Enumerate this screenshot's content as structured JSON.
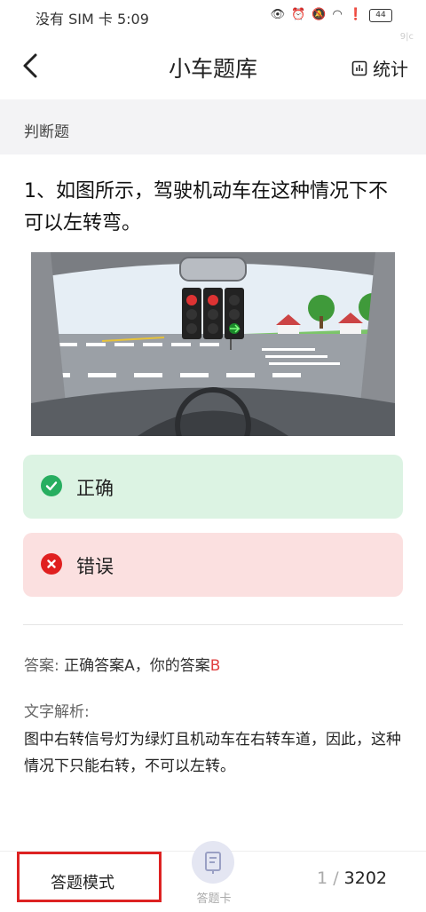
{
  "status_bar": {
    "time": "没有 SIM 卡 5:09",
    "battery": "44"
  },
  "header": {
    "title": "小车题库",
    "stats_label": "统计",
    "watermark": "9|c"
  },
  "section": {
    "label": "判断题"
  },
  "question": {
    "text": "1、如图所示，驾驶机动车在这种情况下不可以左转弯。"
  },
  "options": [
    {
      "label": "正确",
      "state": "correct"
    },
    {
      "label": "错误",
      "state": "wrong"
    }
  ],
  "answer": {
    "prefix": "答案:",
    "correct_text": "正确答案A，你的答案",
    "user_choice": "B"
  },
  "analysis": {
    "label": "文字解析:",
    "text": "图中右转信号灯为绿灯且机动车在右转车道，因此，这种情况下只能右转，不可以左转。"
  },
  "bottom_bar": {
    "mode_label": "答题模式",
    "card_label": "答题卡",
    "current_page": "1",
    "separator": "/",
    "total_pages": "3202"
  },
  "colors": {
    "correct": "#27ae60",
    "wrong": "#e02020",
    "highlight_box": "#dd2222"
  }
}
